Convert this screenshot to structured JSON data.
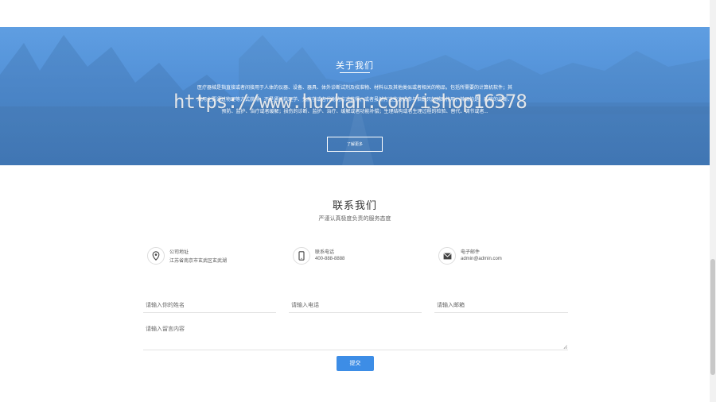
{
  "about": {
    "title": "关于我们",
    "description": "医疗器械是指直接或者间接用于人体的仪器、设备、器具、体外诊断试剂及校准物、材料以及其他类似或者相关的物品，包括所需要的计算机软件；其效用主要通过物理等方式获得，不是通过药理学、免疫学或者代谢的方式获得，或者虽然有这些方式参与但是只起辅助作用；其目的是：疾病的诊断、预防、监护、治疗或者缓解；损伤的诊断、监护、治疗、缓解或者功能补偿；生理结构或者生理过程的检验、替代、调节或者...",
    "more_label": "了解更多",
    "watermark": "https://www.huzhan.com/ishop16378"
  },
  "contact": {
    "title": "联系我们",
    "subtitle": "严谨认真极度负责的服务态度",
    "info": [
      {
        "icon": "location-pin-icon",
        "label": "公司地址",
        "value": "江苏省南京市玄武区玄武湖"
      },
      {
        "icon": "phone-icon",
        "label": "联系电话",
        "value": "400-888-8888"
      },
      {
        "icon": "mail-icon",
        "label": "电子邮件",
        "value": "admin@admin.com"
      }
    ],
    "form": {
      "name_placeholder": "请输入你的姓名",
      "phone_placeholder": "请输入电话",
      "email_placeholder": "请输入邮箱",
      "message_placeholder": "请输入留言内容",
      "submit_label": "提交"
    }
  },
  "colors": {
    "accent": "#3d8de6",
    "banner": "#4f8fd8"
  }
}
